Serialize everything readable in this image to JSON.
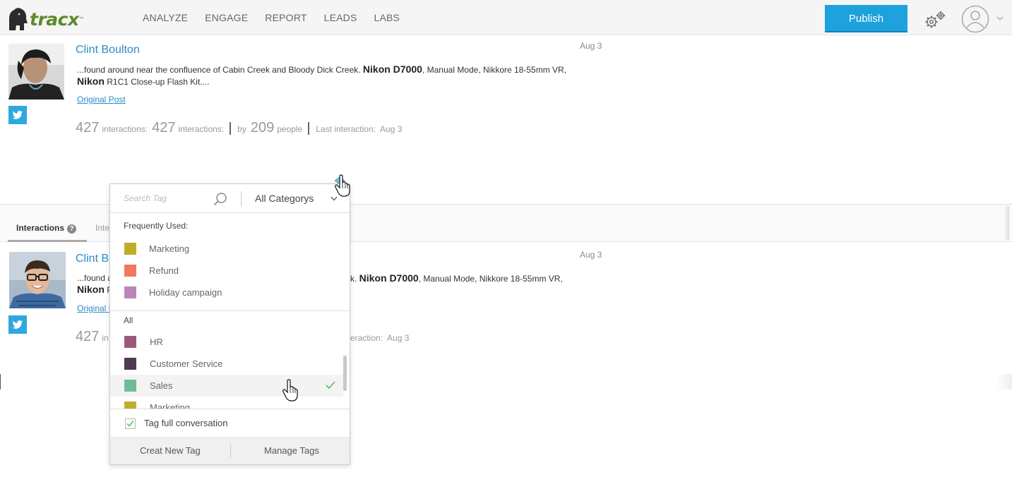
{
  "header": {
    "logo_text": "tracx",
    "logo_tm": "™",
    "nav": [
      "ANALYZE",
      "ENGAGE",
      "REPORT",
      "LEADS",
      "LABS"
    ],
    "publish_label": "Publish"
  },
  "posts": [
    {
      "author": "Clint Boulton",
      "date": "Aug 3",
      "text_pre": "...found around near the confluence of Cabin Creek and Bloody Dick Creek. ",
      "bold1": "Nikon D7000",
      "text_mid": ", Manual Mode, Nikkore 18-55mm VR, ",
      "bold2": "Nikon",
      "text_post": " R1C1 Close-up Flash Kit....",
      "link": "Original Post",
      "stats": {
        "n1": "427",
        "l1": "interactions:",
        "n2": "427",
        "l2": "interactions:",
        "by": "by",
        "n3": "209",
        "l3": "people",
        "last": "Last interaction:",
        "last_date": "Aug 3"
      }
    },
    {
      "author": "Clint B",
      "date": "Aug 3",
      "text_pre": "...found a",
      "text_tail": "k. ",
      "bold1": "Nikon D7000",
      "text_mid": ", Manual Mode, Nikkore 18-55mm VR,",
      "bold2": "Nikon",
      "text_post": " R",
      "link": "Original I",
      "stats": {
        "n1": "427",
        "l1": "in",
        "last_partial": "eraction:",
        "last_date": "Aug 3"
      }
    }
  ],
  "tabs": {
    "active": "Interactions",
    "help": "?",
    "second": "Inte"
  },
  "tag_panel": {
    "search_placeholder": "Search Tag",
    "category": "All Categorys",
    "frequently_label": "Frequently Used:",
    "frequent": [
      {
        "name": "Marketing",
        "color": "#bfae2a"
      },
      {
        "name": "Refund",
        "color": "#f2775f"
      },
      {
        "name": "Holiday campaign",
        "color": "#b886b9"
      }
    ],
    "all_label": "All",
    "all": [
      {
        "name": "HR",
        "color": "#9a5a7e"
      },
      {
        "name": "Customer Service",
        "color": "#4e3a52"
      },
      {
        "name": "Sales",
        "color": "#6fbc98",
        "selected": true
      },
      {
        "name": "Marketing",
        "color": "#bfae2a"
      }
    ],
    "full_conv_label": "Tag full conversation",
    "full_conv_checked": true,
    "create_label": "Creat New Tag",
    "manage_label": "Manage Tags"
  },
  "colors": {
    "accent": "#1ea2dd",
    "link": "#2a8cc4",
    "twitter": "#2fa8df",
    "check": "#5cb85c"
  }
}
